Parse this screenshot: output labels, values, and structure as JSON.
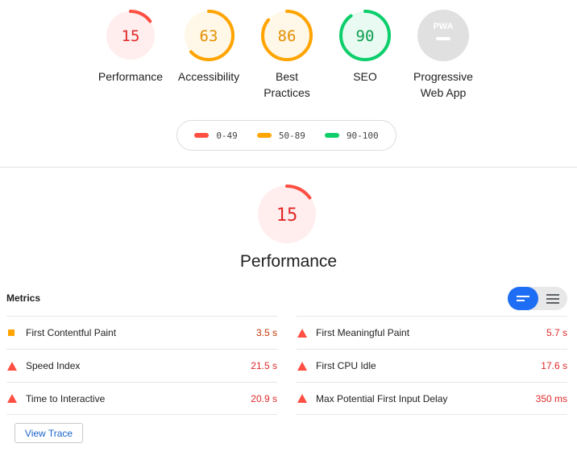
{
  "categories": [
    {
      "key": "performance",
      "score": "15",
      "label": "Performance",
      "fraction": 0.15,
      "color": "#ff4e42",
      "bg": "#ffeeed",
      "text": "#e0282a"
    },
    {
      "key": "accessibility",
      "score": "63",
      "label": "Accessibility",
      "fraction": 0.63,
      "color": "#ffa400",
      "bg": "#fff7e8",
      "text": "#e38f00"
    },
    {
      "key": "best-practices",
      "score": "86",
      "label_line1": "Best",
      "label_line2": "Practices",
      "fraction": 0.86,
      "color": "#ffa400",
      "bg": "#fff7e8",
      "text": "#e38f00"
    },
    {
      "key": "seo",
      "score": "90",
      "label": "SEO",
      "fraction": 0.9,
      "color": "#0cce6b",
      "bg": "#e8faf1",
      "text": "#0a9e50"
    },
    {
      "key": "pwa",
      "label_line1": "Progressive",
      "label_line2": "Web App",
      "badge_text": "PWA",
      "bg": "#e0e0e0"
    }
  ],
  "legend": [
    {
      "range": "0-49",
      "color": "#ff4e42"
    },
    {
      "range": "50-89",
      "color": "#ffa400"
    },
    {
      "range": "90-100",
      "color": "#0cce6b"
    }
  ],
  "performance": {
    "score": "15",
    "fraction": 0.15,
    "title": "Performance",
    "color": "#ff4e42",
    "bg": "#ffeeed",
    "text": "#e0282a"
  },
  "metrics": {
    "title": "Metrics",
    "toggle_active": "summary",
    "left": [
      {
        "icon": "orange-square-icon",
        "name": "First Contentful Paint",
        "value": "3.5 s",
        "status": "average"
      },
      {
        "icon": "red-triangle-icon",
        "name": "Speed Index",
        "value": "21.5 s",
        "status": "fail"
      },
      {
        "icon": "red-triangle-icon",
        "name": "Time to Interactive",
        "value": "20.9 s",
        "status": "fail"
      }
    ],
    "right": [
      {
        "icon": "red-triangle-icon",
        "name": "First Meaningful Paint",
        "value": "5.7 s",
        "status": "fail"
      },
      {
        "icon": "red-triangle-icon",
        "name": "First CPU Idle",
        "value": "17.6 s",
        "status": "fail"
      },
      {
        "icon": "red-triangle-icon",
        "name": "Max Potential First Input Delay",
        "value": "350 ms",
        "status": "fail"
      }
    ]
  },
  "buttons": {
    "view_trace": "View Trace"
  }
}
